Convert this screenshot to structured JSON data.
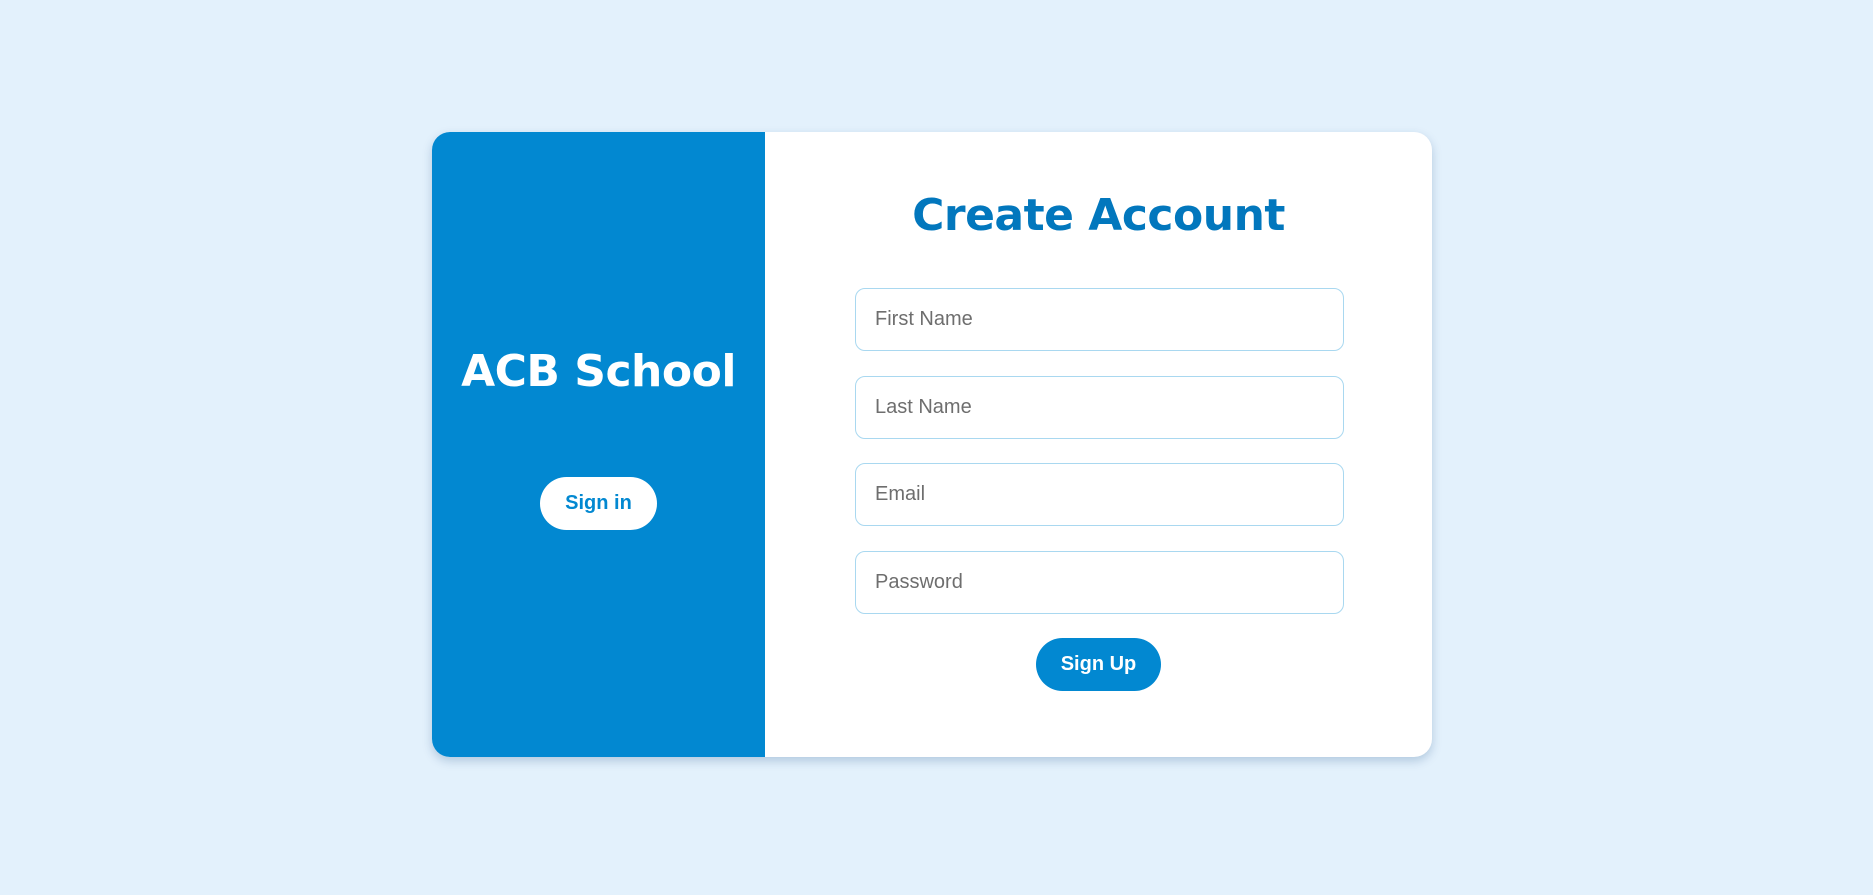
{
  "left_panel": {
    "brand": "ACB School",
    "signin_label": "Sign in"
  },
  "form": {
    "title": "Create Account",
    "first_name": {
      "value": "",
      "placeholder": "First Name"
    },
    "last_name": {
      "value": "",
      "placeholder": "Last Name"
    },
    "email": {
      "value": "",
      "placeholder": "Email"
    },
    "password": {
      "value": "",
      "placeholder": "Password"
    },
    "signup_label": "Sign Up"
  },
  "colors": {
    "page_background": "#e3f1fc",
    "primary": "#0288d1",
    "title": "#0277bd",
    "card": "#ffffff",
    "field_border": "#a9d8f0"
  }
}
